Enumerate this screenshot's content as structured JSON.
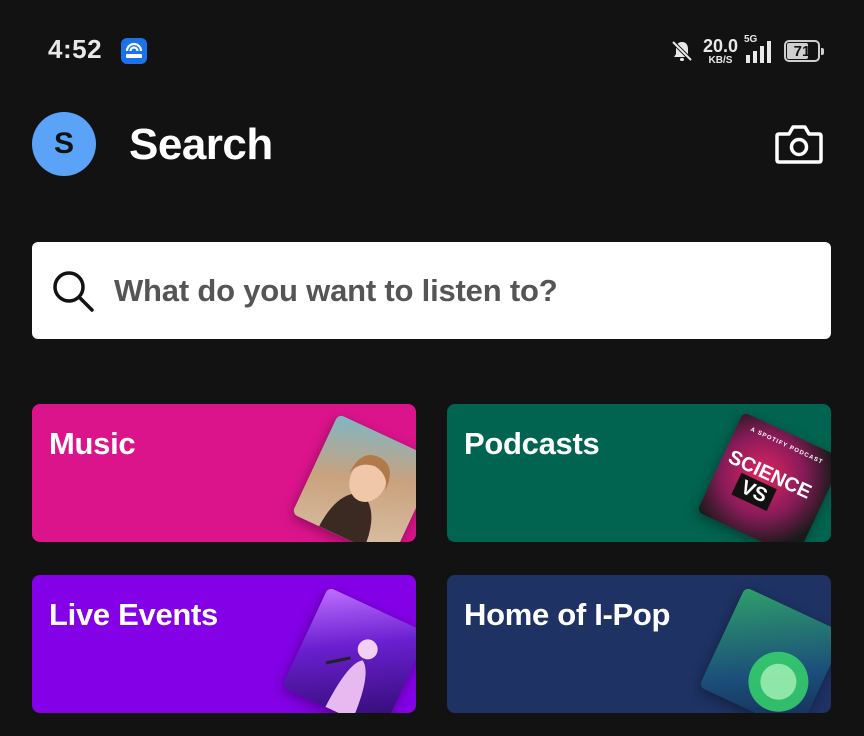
{
  "status_bar": {
    "time": "4:52",
    "net_speed": "20.0",
    "net_speed_unit": "KB/S",
    "network_type": "5G",
    "battery_level": "71",
    "battery_fraction": 0.71
  },
  "header": {
    "avatar_initial": "S",
    "title": "Search"
  },
  "search": {
    "placeholder": "What do you want to listen to?"
  },
  "categories": [
    {
      "label": "Music",
      "color": "#dc148c",
      "art": "artist-portrait-image"
    },
    {
      "label": "Podcasts",
      "color": "#006450",
      "art": "podcast-cover-image"
    },
    {
      "label": "Live Events",
      "color": "#8400e7",
      "art": "concert-photo-image"
    },
    {
      "label": "Home of I-Pop",
      "color": "#1e3264",
      "art": "playlist-cover-image"
    }
  ],
  "podcast_cover": {
    "title_line1": "SCIENCE",
    "title_line2": "VS",
    "tagline": "A SPOTIFY PODCAST"
  },
  "colors": {
    "background": "#121212",
    "avatar": "#5aa3f8",
    "search_box": "#ffffff"
  },
  "icons": [
    "hotspot-icon",
    "bell-off-icon",
    "signal-icon",
    "battery-icon",
    "camera-icon",
    "search-icon"
  ]
}
